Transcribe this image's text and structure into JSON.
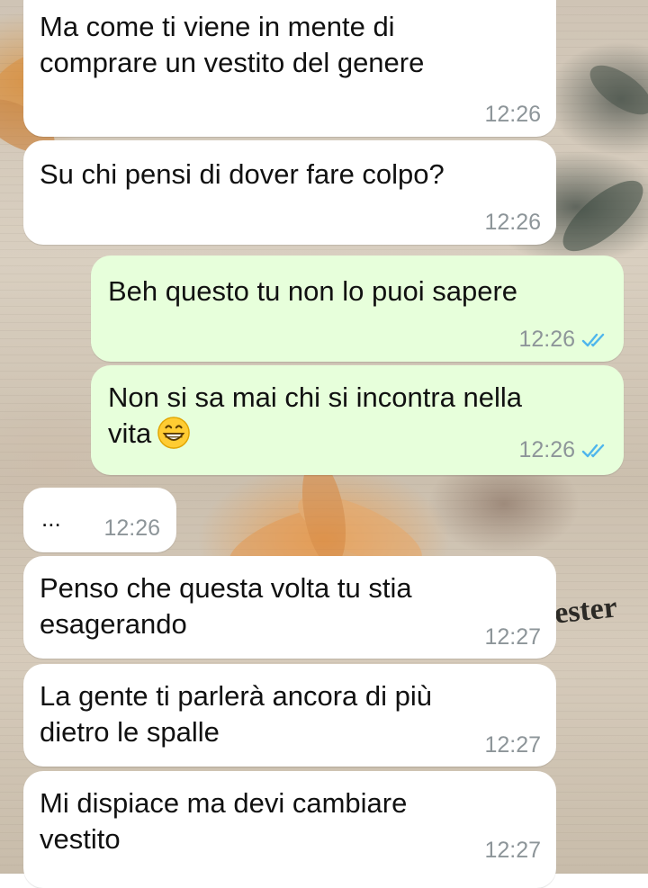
{
  "wallpaper": {
    "newspaper_fragment": "ester"
  },
  "colors": {
    "incoming_bubble": "#ffffff",
    "outgoing_bubble": "#e7ffdb",
    "timestamp": "#8d9599",
    "read_ticks": "#4fb6ec"
  },
  "messages": [
    {
      "direction": "in",
      "text": "Ma come ti viene in mente di\ncomprare un vestito del genere",
      "time": "12:26"
    },
    {
      "direction": "in",
      "text": "Su chi pensi di dover fare colpo?",
      "time": "12:26"
    },
    {
      "direction": "out",
      "text": "Beh questo tu non lo puoi sapere",
      "time": "12:26",
      "status_icon": "double-check-read-icon"
    },
    {
      "direction": "out",
      "text": "Non si sa mai chi si incontra nella\nvita",
      "emoji": "grinning-face-icon",
      "time": "12:26",
      "status_icon": "double-check-read-icon"
    },
    {
      "direction": "in",
      "text": "...",
      "time": "12:26"
    },
    {
      "direction": "in",
      "text": "Penso che questa volta tu stia\nesagerando",
      "time": "12:27"
    },
    {
      "direction": "in",
      "text": "La gente ti parlerà ancora di più\ndietro le spalle",
      "time": "12:27"
    },
    {
      "direction": "in",
      "text": "Mi dispiace ma devi cambiare\nvestito",
      "time": "12:27"
    }
  ]
}
